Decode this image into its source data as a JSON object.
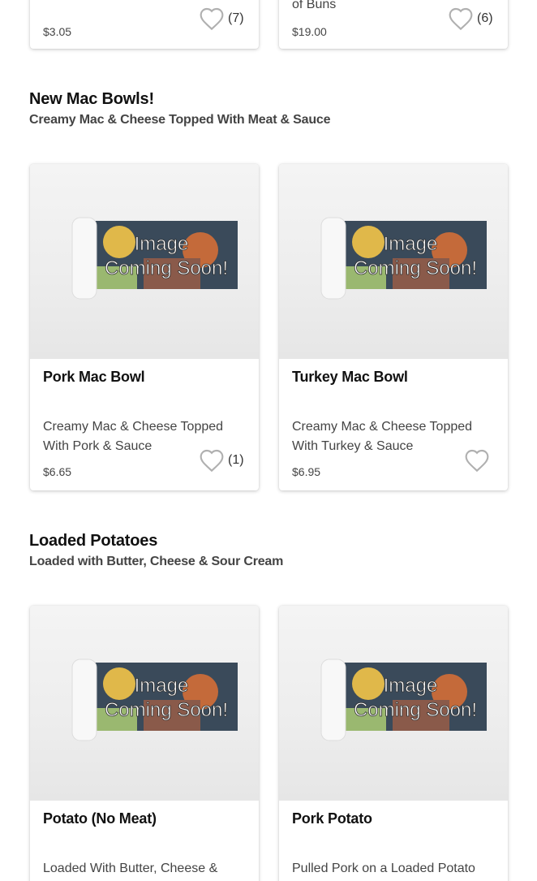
{
  "top_row": [
    {
      "price": "$3.05",
      "favorites": "(7)"
    },
    {
      "name_tail": "of Buns",
      "price": "$19.00",
      "favorites": "(6)"
    }
  ],
  "sections": [
    {
      "title": "New Mac Bowls!",
      "subtitle": "Creamy Mac & Cheese Topped With Meat & Sauce",
      "items": [
        {
          "name": "Pork Mac Bowl",
          "description": "Creamy Mac & Cheese Topped With Pork & Sauce",
          "price": "$6.65",
          "favorites": "(1)",
          "image_text": "Image Coming Soon!"
        },
        {
          "name": "Turkey Mac Bowl",
          "description": "Creamy Mac & Cheese Topped With Turkey & Sauce",
          "price": "$6.95",
          "favorites": "",
          "image_text": "Image Coming Soon!"
        }
      ]
    },
    {
      "title": "Loaded Potatoes",
      "subtitle": "Loaded with Butter, Cheese & Sour Cream",
      "items": [
        {
          "name": "Potato (No Meat)",
          "description": "Loaded With Butter, Cheese & Sour",
          "image_text": "Image Coming Soon!"
        },
        {
          "name": "Pork Potato",
          "description": "Pulled Pork on a Loaded Potato",
          "image_text": "Image Coming Soon!"
        }
      ]
    }
  ],
  "icons": {
    "favorite": "heart-outline-icon"
  },
  "colors": {
    "heart": "#b0b0b0",
    "text": "#111111",
    "muted": "#444444"
  }
}
